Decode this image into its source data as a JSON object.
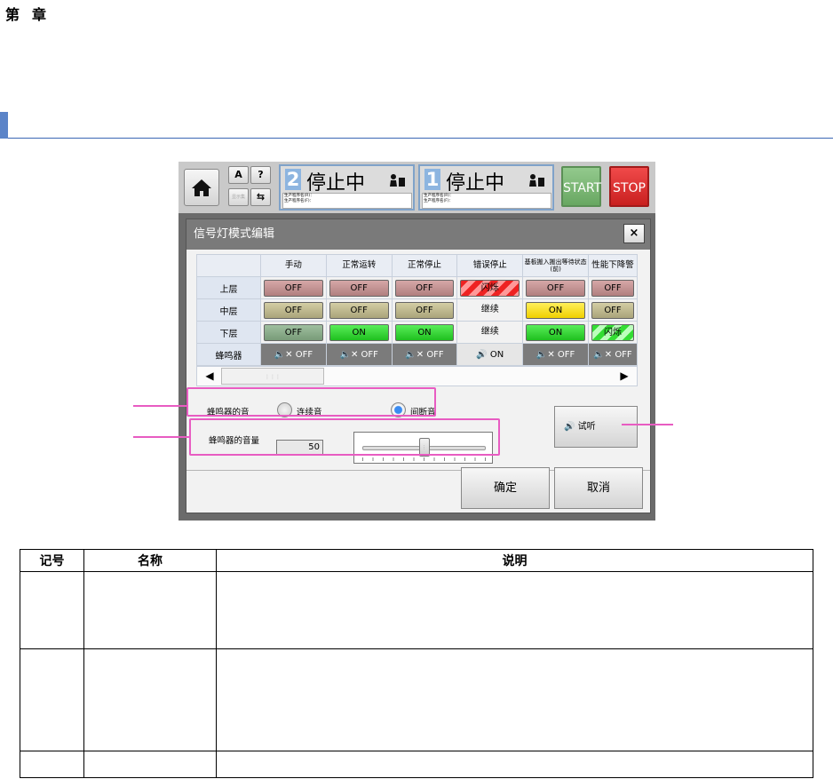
{
  "chapter": {
    "first": "第",
    "second": "章"
  },
  "topbar": {
    "small_buttons": [
      "A",
      "?",
      "显示集",
      "⇆"
    ],
    "panels": [
      {
        "num": "2",
        "status": "停止中",
        "sub1": "生产程序名(R)：",
        "sub2": "生产程序名(F)："
      },
      {
        "num": "1",
        "status": "停止中",
        "sub1": "生产程序名(R)：",
        "sub2": "生产程序名(F)："
      }
    ],
    "start": "START",
    "stop": "STOP"
  },
  "dialog": {
    "title": "信号灯模式编辑",
    "close": "×",
    "columns": [
      "手动",
      "正常运转",
      "正常停止",
      "错误停止",
      "基板搬入搬出等待状态(前)",
      "性能下降警"
    ],
    "rows": [
      {
        "label": "上层",
        "cells": [
          "OFF",
          "OFF",
          "OFF",
          "闪烁",
          "OFF",
          "OFF"
        ]
      },
      {
        "label": "中层",
        "cells": [
          "OFF",
          "OFF",
          "OFF",
          "继续",
          "ON",
          "OFF"
        ]
      },
      {
        "label": "下层",
        "cells": [
          "OFF",
          "ON",
          "ON",
          "继续",
          "ON",
          "闪烁"
        ]
      },
      {
        "label": "蜂鸣器",
        "cells": [
          "OFF",
          "OFF",
          "OFF",
          "ON",
          "OFF",
          "OFF"
        ]
      }
    ],
    "buzzer_sound_label": "蜂鸣器的音",
    "option_continuous": "连续音",
    "option_intermittent": "间断音",
    "volume_label": "蜂鸣器的音量",
    "volume_value": "50",
    "listen_button": "试听",
    "ok_button": "确定",
    "cancel_button": "取消"
  },
  "doc_table": {
    "headers": [
      "记号",
      "名称",
      "说明"
    ]
  },
  "colors": {
    "highlight": "#e85cc2",
    "section_blue": "#5b84c8",
    "start_green": "#7fb877",
    "stop_red": "#e03333"
  }
}
